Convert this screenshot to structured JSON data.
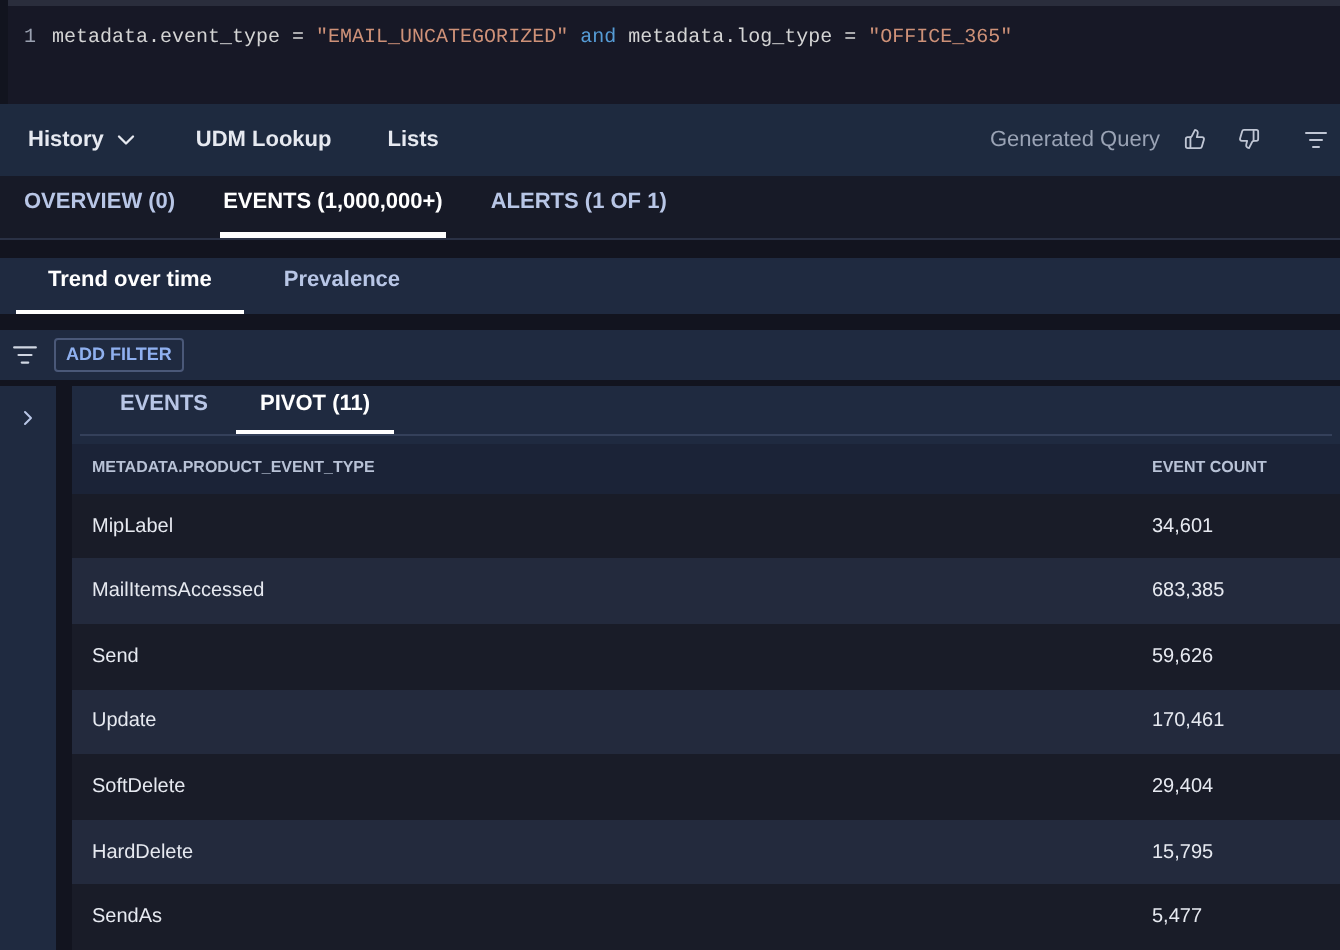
{
  "editor": {
    "line_number": "1",
    "tokens": [
      {
        "kind": "plain",
        "text": "metadata.event_type = "
      },
      {
        "kind": "string",
        "text": "\"EMAIL_UNCATEGORIZED\""
      },
      {
        "kind": "keyword",
        "text": " and "
      },
      {
        "kind": "plain",
        "text": "metadata.log_type = "
      },
      {
        "kind": "string",
        "text": "\"OFFICE_365\""
      }
    ]
  },
  "toolbar": {
    "items": [
      "History",
      "UDM Lookup",
      "Lists"
    ],
    "generated_query": "Generated Query"
  },
  "tabs": [
    {
      "label": "OVERVIEW (0)",
      "selected": false
    },
    {
      "label": "EVENTS (1,000,000+)",
      "selected": true
    },
    {
      "label": "ALERTS (1 OF 1)",
      "selected": false
    }
  ],
  "view_tabs": [
    {
      "label": "Trend over time",
      "selected": true
    },
    {
      "label": "Prevalence",
      "selected": false
    }
  ],
  "filter_button": "ADD FILTER",
  "result_tabs": [
    {
      "label": "EVENTS",
      "selected": false
    },
    {
      "label": "PIVOT (11)",
      "selected": true
    }
  ],
  "table": {
    "columns": [
      "METADATA.PRODUCT_EVENT_TYPE",
      "EVENT COUNT"
    ],
    "rows": [
      [
        "MipLabel",
        "34,601"
      ],
      [
        "MailItemsAccessed",
        "683,385"
      ],
      [
        "Send",
        "59,626"
      ],
      [
        "Update",
        "170,461"
      ],
      [
        "SoftDelete",
        "29,404"
      ],
      [
        "HardDelete",
        "15,795"
      ],
      [
        "SendAs",
        "5,477"
      ]
    ]
  }
}
